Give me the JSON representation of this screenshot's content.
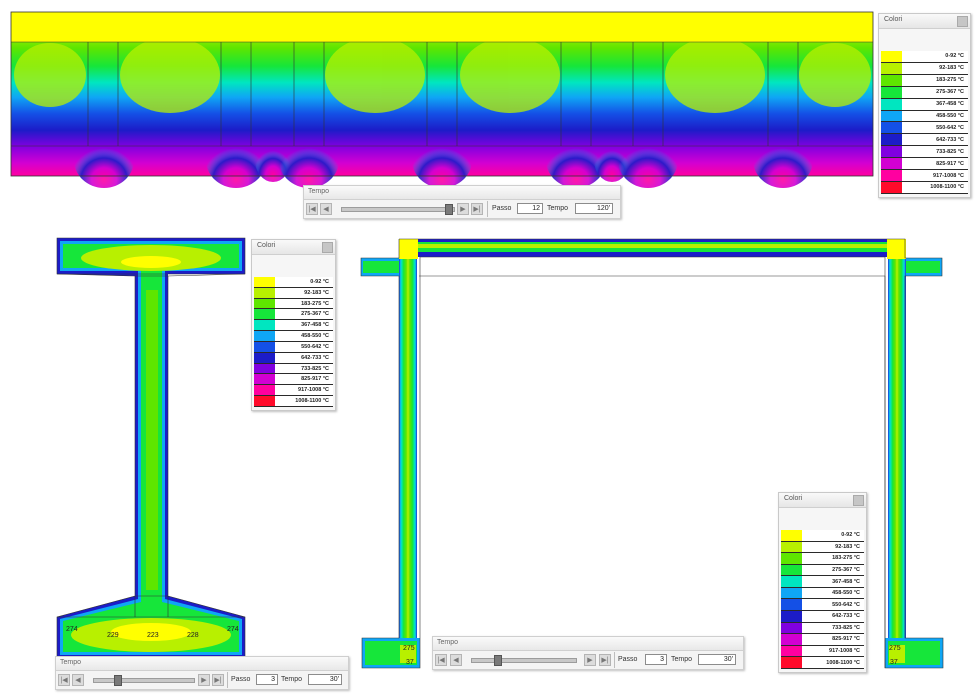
{
  "legend": {
    "title": "Colori",
    "ranges": [
      "0-92 °C",
      "92-183 °C",
      "183-275 °C",
      "275-367 °C",
      "367-458 °C",
      "458-550 °C",
      "550-642 °C",
      "642-733 °C",
      "733-825 °C",
      "825-917 °C",
      "917-1008 °C",
      "1008-1100 °C"
    ],
    "colors": [
      "#ffff00",
      "#b8f000",
      "#5ee600",
      "#16e63a",
      "#00e6c0",
      "#0fa6f5",
      "#1450e6",
      "#1c1cc8",
      "#8000e0",
      "#d200d2",
      "#ff00a0",
      "#ff0a2a"
    ]
  },
  "tempo_top": {
    "title": "Tempo",
    "passo_label": "Passo",
    "passo": "12",
    "tempo_label": "Tempo",
    "tempo": "120'"
  },
  "tempo_bl": {
    "title": "Tempo",
    "passo_label": "Passo",
    "passo": "3",
    "tempo_label": "Tempo",
    "tempo": "30'"
  },
  "tempo_br": {
    "title": "Tempo",
    "passo_label": "Passo",
    "passo": "3",
    "tempo_label": "Tempo",
    "tempo": "30'"
  },
  "ibeam_labels": [
    "274",
    "229",
    "223",
    "228",
    "274"
  ],
  "frame_labels": {
    "left": "275",
    "right": "275",
    "left_small": "37",
    "right_small": "37"
  }
}
